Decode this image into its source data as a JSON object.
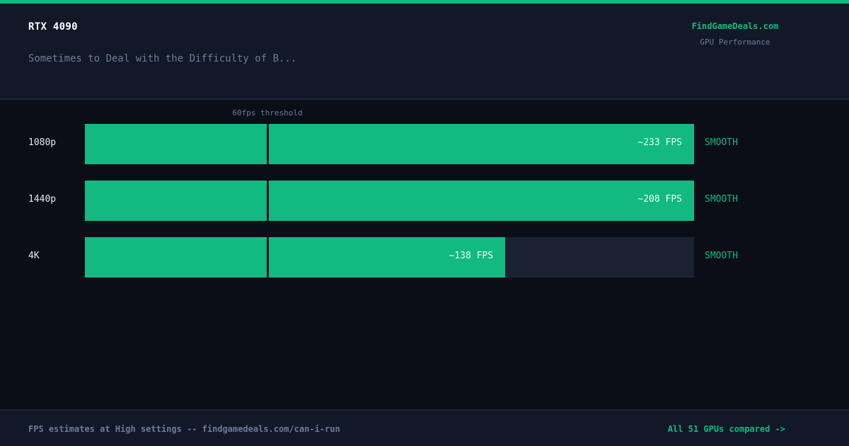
{
  "header": {
    "gpu_name": "RTX 4090",
    "game_name": "Sometimes to Deal with the Difficulty of B...",
    "brand": "FindGameDeals.com",
    "brand_subtitle": "GPU Performance"
  },
  "colors": {
    "accent": "#12b981",
    "background": "#0b0e17",
    "panel": "#121827",
    "track": "#1a2133",
    "muted_text": "#6b7c9c"
  },
  "chart_data": {
    "type": "bar",
    "orientation": "horizontal",
    "categories": [
      "1080p",
      "1440p",
      "4K"
    ],
    "values": [
      233,
      208,
      138
    ],
    "value_labels": [
      "~233 FPS",
      "~208 FPS",
      "~138 FPS"
    ],
    "status_labels": [
      "SMOOTH",
      "SMOOTH",
      "SMOOTH"
    ],
    "xlim": [
      0,
      200
    ],
    "threshold": {
      "value": 60,
      "label": "60fps threshold"
    }
  },
  "footer": {
    "note": "FPS estimates at High settings -- findgamedeals.com/can-i-run",
    "link": "All 51 GPUs compared ->"
  }
}
